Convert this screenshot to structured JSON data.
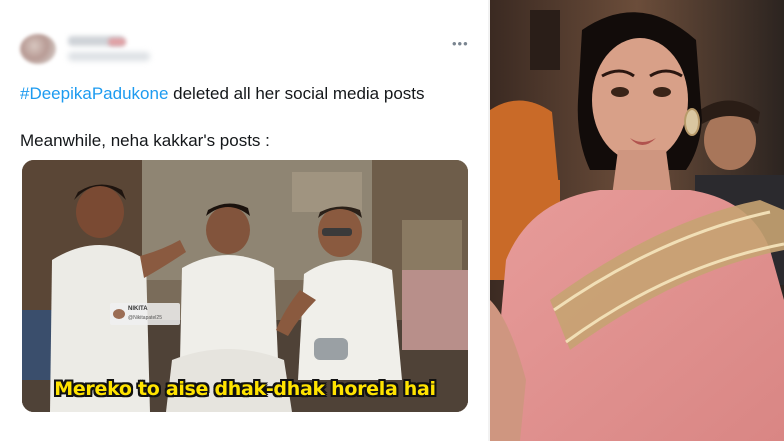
{
  "tweet": {
    "more_icon": "more-dots-icon",
    "more_label": "•••",
    "hashtag": "#DeepikaPadukone",
    "line1_rest": " deleted all her social media posts",
    "line2": "Meanwhile, neha kakkar's posts :"
  },
  "meme": {
    "caption": "Mereko to aise dhak-dhak horela hai",
    "watermark_name": "NIKITA",
    "watermark_handle": "@Nikitapatel25"
  },
  "colors": {
    "hashtag": "#1d9bf0",
    "caption": "#ffe300",
    "text": "#14171a"
  }
}
